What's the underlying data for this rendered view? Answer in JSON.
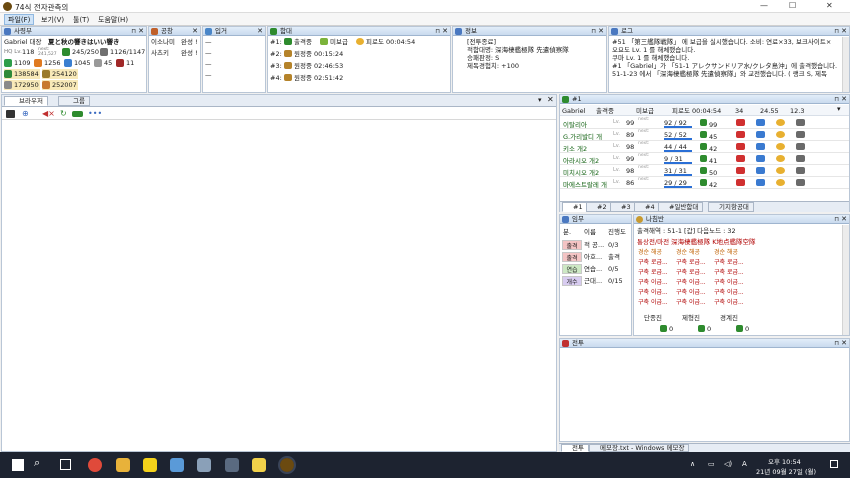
{
  "window": {
    "title": "74식 전자관측의",
    "min": "—",
    "max": "☐",
    "close": "✕"
  },
  "menu": [
    "파일(F)",
    "보기(V)",
    "툴(T)",
    "도움말(H)"
  ],
  "commander": {
    "title": "사령부",
    "name": "Gabriel 대장",
    "motto": "夏と秋の響きはいい響き",
    "hq_level_label": "HQ Lv.",
    "hq_level": "118",
    "next_label": "next:",
    "next_value": "241,527",
    "ships": "245/250",
    "equip": "1126/1147",
    "items": [
      "1109",
      "1256",
      "1045",
      "45",
      "11"
    ],
    "fuel": "138584",
    "ammo": "254120",
    "steel": "172950",
    "bauxite": "252007"
  },
  "factory": {
    "title": "공창",
    "rows": [
      {
        "name": "이소나미",
        "state": "완성 !"
      },
      {
        "name": "사츠키",
        "state": "완성 !"
      }
    ]
  },
  "dock": {
    "title": "입거",
    "rows": [
      "—",
      "—",
      "—",
      "—"
    ]
  },
  "expedition": {
    "title": "함대",
    "rows": [
      {
        "fleet": "#1:",
        "state": "출격중",
        "sub": "미보급",
        "extra": "피로도 00:04:54"
      },
      {
        "fleet": "#2:",
        "state": "원정중 00:15:24"
      },
      {
        "fleet": "#3:",
        "state": "원정중 02:46:53"
      },
      {
        "fleet": "#4:",
        "state": "원정중 02:51:42"
      }
    ]
  },
  "info": {
    "title": "정보",
    "lines": [
      "[전투종료]",
      "적함대명: 深海棲艦極隊 先遣偵察隊",
      "승패판정: S",
      "제독경험치: +100"
    ]
  },
  "log": {
    "title": "로그",
    "lines": [
      "#51 「第三艦隊戦隊」 에 보급을 실시했습니다. 소비: 연료×33, 보크사이트×",
      "오요도 Lv. 1 를 해체했습니다.",
      "쿠마 Lv. 1 를 해체했습니다.",
      "#1 「Gabriel」가 「51-1 アレクサンドリア水/クレタ島沖」에 출격했습니다.",
      "51-1-23 에서 「深海棲艦極隊 先遣偵察隊」와 교전했습니다. ( 랭크 S, 제독"
    ]
  },
  "browser": {
    "tab_browser": "브라우저",
    "tab_group": "그룹"
  },
  "fleet": {
    "tab": "#1",
    "status": "출격중",
    "supply": "미보급",
    "fatigue": "피로도 00:04:54",
    "stat1": "34",
    "stat2": "24.55",
    "stat3": "12.3",
    "name": "Gabriel",
    "ships": [
      {
        "name": "이탈리아",
        "lv": "99",
        "hp": "92 / 92",
        "cond": "99"
      },
      {
        "name": "G.가리발디 개",
        "lv": "89",
        "hp": "52 / 52",
        "cond": "45"
      },
      {
        "name": "키소 개2",
        "lv": "98",
        "hp": "44 / 44",
        "cond": "42"
      },
      {
        "name": "아라시오 개2",
        "lv": "99",
        "hp": "9 / 31",
        "cond": "41"
      },
      {
        "name": "미치시오 개2",
        "lv": "98",
        "hp": "31 / 31",
        "cond": "50"
      },
      {
        "name": "마에스트랄레 개",
        "lv": "86",
        "hp": "29 / 29",
        "cond": "42"
      }
    ],
    "lv_label": "Lv.",
    "bottom_tabs": [
      "#1",
      "#2",
      "#3",
      "#4",
      "#일반함대",
      "기지항공대"
    ]
  },
  "quest": {
    "title": "임무",
    "headers": [
      "분.",
      "이름",
      "진행도"
    ],
    "rows": [
      {
        "cat": "출격",
        "name": "적 공...",
        "prog": "0/3"
      },
      {
        "cat": "출격",
        "name": "아호...",
        "prog": "출격"
      },
      {
        "cat": "연습",
        "name": "연습...",
        "prog": "0/5"
      },
      {
        "cat": "개수",
        "name": "근대...",
        "prog": "0/15"
      }
    ]
  },
  "compass": {
    "title": "나침반",
    "header": "출격해역 : 51-1 [갑]  다음노드 : 32",
    "enemy": "통상전/마전  深海棲艦極隊 K地点艦隊空隊",
    "cols": [
      [
        "경순 해공",
        "구축 로급...",
        "구축 로급...",
        "구축 이급...",
        "구축 이급...",
        "구축 이급..."
      ],
      [
        "경순 해공",
        "구축 로급...",
        "구축 로급...",
        "구축 이급...",
        "구축 이급...",
        "구축 이급..."
      ],
      [
        "경순 해공",
        "구축 로급...",
        "구축 로급...",
        "구축 이급...",
        "구축 이급...",
        "구축 이급..."
      ]
    ],
    "formations": [
      "단종진",
      "제형진",
      "경계진"
    ],
    "air": [
      "0",
      "0",
      "0"
    ]
  },
  "battle": {
    "title": "전투"
  },
  "bottom_tabs": {
    "battle": "전투",
    "memo": "메모장.txt - Windows 메모장"
  },
  "taskbar": {
    "time": "오후 10:54",
    "date": "21년 09월 27일 (월)"
  }
}
